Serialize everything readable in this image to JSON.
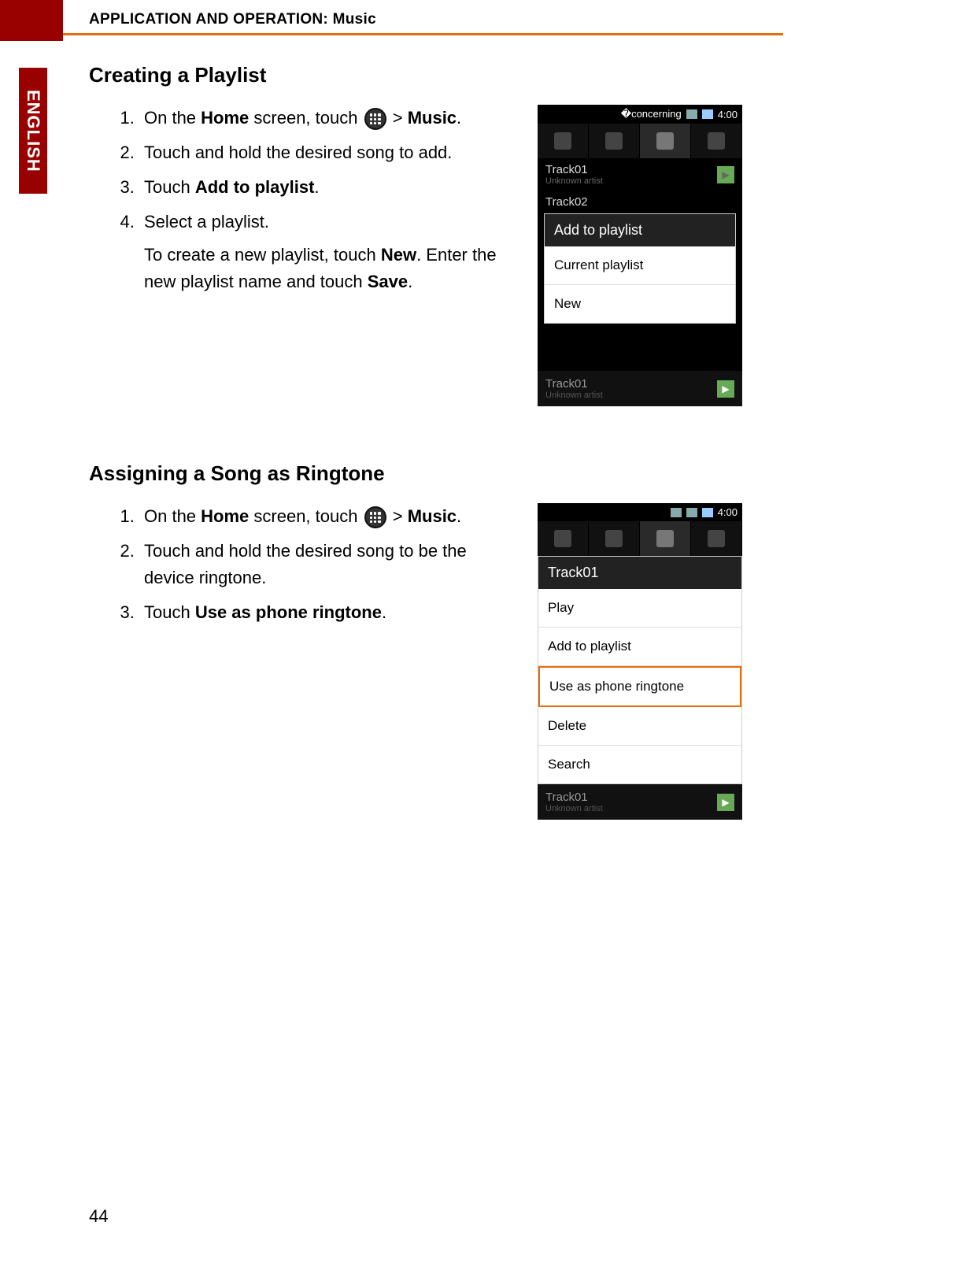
{
  "header": {
    "title": "APPLICATION AND OPERATION: Music"
  },
  "side_tab": "ENGLISH",
  "page_number": "44",
  "sections": {
    "playlist": {
      "title": "Creating a Playlist",
      "step1_a": "On the ",
      "step1_home": "Home",
      "step1_b": " screen, touch ",
      "step1_gt": " > ",
      "step1_music": "Music",
      "step1_end": ".",
      "step2": "Touch and hold the desired song to add.",
      "step3_a": "Touch ",
      "step3_b": "Add to playlist",
      "step3_end": ".",
      "step4": "Select a playlist.",
      "step4_note_a": "To create a new playlist, touch ",
      "step4_note_new": "New",
      "step4_note_b": ". Enter the new playlist name and touch ",
      "step4_note_save": "Save",
      "step4_note_end": "."
    },
    "ringtone": {
      "title": "Assigning a Song as Ringtone",
      "step1_a": "On the ",
      "step1_home": "Home",
      "step1_b": " screen, touch ",
      "step1_gt": " > ",
      "step1_music": "Music",
      "step1_end": ".",
      "step2": "Touch and hold the desired song to be the device ringtone.",
      "step3_a": "Touch ",
      "step3_b": "Use as phone ringtone",
      "step3_end": "."
    }
  },
  "phone1": {
    "time": "4:00",
    "track1": "Track01",
    "track1_artist": "Unknown artist",
    "track2": "Track02",
    "popup_header": "Add to playlist",
    "popup_item1": "Current playlist",
    "popup_item2": "New",
    "nowplaying": "Track01",
    "nowplaying_artist": "Unknown artist"
  },
  "phone2": {
    "time": "4:00",
    "popup_header": "Track01",
    "popup_item1": "Play",
    "popup_item2": "Add to playlist",
    "popup_item3": "Use as phone ringtone",
    "popup_item4": "Delete",
    "popup_item5": "Search",
    "nowplaying": "Track01",
    "nowplaying_artist": "Unknown artist"
  }
}
